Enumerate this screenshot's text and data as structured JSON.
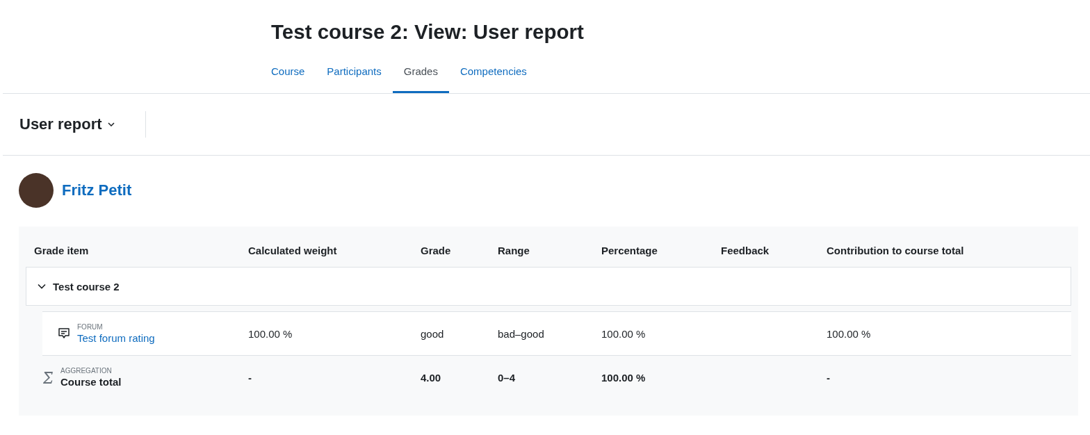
{
  "page_title": "Test course 2: View: User report",
  "tabs": [
    {
      "label": "Course",
      "selected": false
    },
    {
      "label": "Participants",
      "selected": false
    },
    {
      "label": "Grades",
      "selected": true
    },
    {
      "label": "Competencies",
      "selected": false
    }
  ],
  "report_selector": {
    "label": "User report"
  },
  "user": {
    "name": "Fritz Petit"
  },
  "table": {
    "columns": [
      "Grade item",
      "Calculated weight",
      "Grade",
      "Range",
      "Percentage",
      "Feedback",
      "Contribution to course total"
    ],
    "category": {
      "name": "Test course 2",
      "expanded": true
    },
    "rows": [
      {
        "kind": "item",
        "type_label": "FORUM",
        "name": "Test forum rating",
        "weight": "100.00 %",
        "grade": "good",
        "range": "bad–good",
        "percentage": "100.00 %",
        "contribution": "100.00 %"
      },
      {
        "kind": "total",
        "type_label": "AGGREGATION",
        "name": "Course total",
        "weight": "-",
        "grade": "4.00",
        "range": "0–4",
        "percentage": "100.00 %",
        "contribution": "-"
      }
    ]
  }
}
